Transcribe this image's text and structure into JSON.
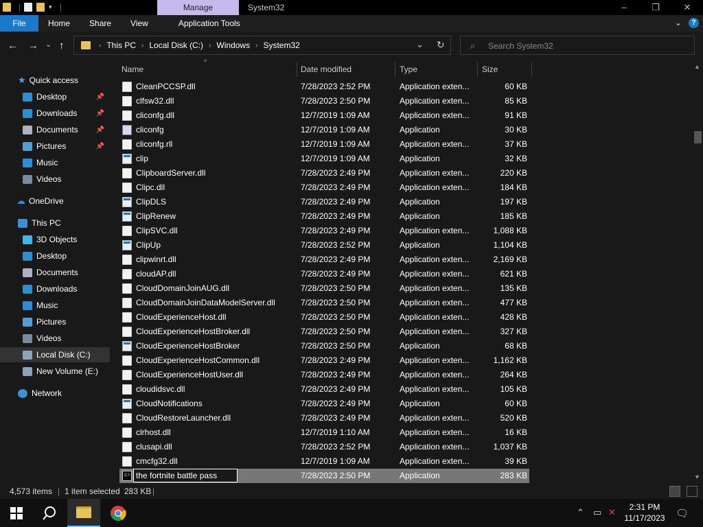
{
  "titlebar": {
    "manage_tab": "Manage",
    "system_tab": "System32",
    "minimize": "–",
    "maximize": "❐",
    "close": "✕"
  },
  "ribbon": {
    "tabs": [
      "File",
      "Home",
      "Share",
      "View",
      "Application Tools"
    ],
    "expand": "⌄",
    "help": "?"
  },
  "address": {
    "back": "←",
    "forward": "→",
    "recent": "⌄",
    "up": "↑",
    "crumbs": [
      "This PC",
      "Local Disk (C:)",
      "Windows",
      "System32"
    ],
    "dropdown": "⌄",
    "refresh": "↻"
  },
  "search": {
    "placeholder": "Search System32",
    "icon": "search-icon"
  },
  "nav": {
    "quick_access": "Quick access",
    "items": [
      {
        "label": "Desktop",
        "icon": "desktop-icon",
        "color": "#2b8fd8",
        "pinned": true
      },
      {
        "label": "Downloads",
        "icon": "download-icon",
        "color": "#2b8fd8",
        "pinned": true
      },
      {
        "label": "Documents",
        "icon": "documents-icon",
        "color": "#aab4c0",
        "pinned": true
      },
      {
        "label": "Pictures",
        "icon": "pictures-icon",
        "color": "#4fa0d8",
        "pinned": true
      },
      {
        "label": "Music",
        "icon": "music-icon",
        "color": "#2b8fd8",
        "pinned": false
      },
      {
        "label": "Videos",
        "icon": "videos-icon",
        "color": "#7a8aa0",
        "pinned": false
      }
    ],
    "onedrive": "OneDrive",
    "this_pc": "This PC",
    "pc_items": [
      {
        "label": "3D Objects",
        "icon": "3d-objects-icon",
        "color": "#3cb7e8"
      },
      {
        "label": "Desktop",
        "icon": "desktop-icon",
        "color": "#2b8fd8"
      },
      {
        "label": "Documents",
        "icon": "documents-icon",
        "color": "#aab4c0"
      },
      {
        "label": "Downloads",
        "icon": "download-icon",
        "color": "#2b8fd8"
      },
      {
        "label": "Music",
        "icon": "music-icon",
        "color": "#2b8fd8"
      },
      {
        "label": "Pictures",
        "icon": "pictures-icon",
        "color": "#4fa0d8"
      },
      {
        "label": "Videos",
        "icon": "videos-icon",
        "color": "#7a8aa0"
      },
      {
        "label": "Local Disk (C:)",
        "icon": "drive-icon",
        "color": "#8aa4c0"
      },
      {
        "label": "New Volume (E:)",
        "icon": "drive-icon",
        "color": "#8aa4c0"
      }
    ],
    "network": "Network"
  },
  "columns": {
    "name": "Name",
    "date": "Date modified",
    "type": "Type",
    "size": "Size"
  },
  "files": [
    {
      "name": "CleanPCCSP.dll",
      "date": "7/28/2023 2:52 PM",
      "type": "Application exten...",
      "size": "60 KB",
      "icon": "dll"
    },
    {
      "name": "clfsw32.dll",
      "date": "7/28/2023 2:50 PM",
      "type": "Application exten...",
      "size": "85 KB",
      "icon": "dll"
    },
    {
      "name": "cliconfg.dll",
      "date": "12/7/2019 1:09 AM",
      "type": "Application exten...",
      "size": "91 KB",
      "icon": "dll"
    },
    {
      "name": "cliconfg",
      "date": "12/7/2019 1:09 AM",
      "type": "Application",
      "size": "30 KB",
      "icon": "cfg"
    },
    {
      "name": "cliconfg.rll",
      "date": "12/7/2019 1:09 AM",
      "type": "Application exten...",
      "size": "37 KB",
      "icon": "dll"
    },
    {
      "name": "clip",
      "date": "12/7/2019 1:09 AM",
      "type": "Application",
      "size": "32 KB",
      "icon": "exe"
    },
    {
      "name": "ClipboardServer.dll",
      "date": "7/28/2023 2:49 PM",
      "type": "Application exten...",
      "size": "220 KB",
      "icon": "dll"
    },
    {
      "name": "Clipc.dll",
      "date": "7/28/2023 2:49 PM",
      "type": "Application exten...",
      "size": "184 KB",
      "icon": "dll"
    },
    {
      "name": "ClipDLS",
      "date": "7/28/2023 2:49 PM",
      "type": "Application",
      "size": "197 KB",
      "icon": "exe"
    },
    {
      "name": "ClipRenew",
      "date": "7/28/2023 2:49 PM",
      "type": "Application",
      "size": "185 KB",
      "icon": "exe"
    },
    {
      "name": "ClipSVC.dll",
      "date": "7/28/2023 2:49 PM",
      "type": "Application exten...",
      "size": "1,088 KB",
      "icon": "dll"
    },
    {
      "name": "ClipUp",
      "date": "7/28/2023 2:52 PM",
      "type": "Application",
      "size": "1,104 KB",
      "icon": "exe"
    },
    {
      "name": "clipwinrt.dll",
      "date": "7/28/2023 2:49 PM",
      "type": "Application exten...",
      "size": "2,169 KB",
      "icon": "dll"
    },
    {
      "name": "cloudAP.dll",
      "date": "7/28/2023 2:49 PM",
      "type": "Application exten...",
      "size": "621 KB",
      "icon": "dll"
    },
    {
      "name": "CloudDomainJoinAUG.dll",
      "date": "7/28/2023 2:50 PM",
      "type": "Application exten...",
      "size": "135 KB",
      "icon": "dll"
    },
    {
      "name": "CloudDomainJoinDataModelServer.dll",
      "date": "7/28/2023 2:50 PM",
      "type": "Application exten...",
      "size": "477 KB",
      "icon": "dll"
    },
    {
      "name": "CloudExperienceHost.dll",
      "date": "7/28/2023 2:50 PM",
      "type": "Application exten...",
      "size": "428 KB",
      "icon": "dll"
    },
    {
      "name": "CloudExperienceHostBroker.dll",
      "date": "7/28/2023 2:50 PM",
      "type": "Application exten...",
      "size": "327 KB",
      "icon": "dll"
    },
    {
      "name": "CloudExperienceHostBroker",
      "date": "7/28/2023 2:50 PM",
      "type": "Application",
      "size": "68 KB",
      "icon": "exe"
    },
    {
      "name": "CloudExperienceHostCommon.dll",
      "date": "7/28/2023 2:49 PM",
      "type": "Application exten...",
      "size": "1,162 KB",
      "icon": "dll"
    },
    {
      "name": "CloudExperienceHostUser.dll",
      "date": "7/28/2023 2:49 PM",
      "type": "Application exten...",
      "size": "264 KB",
      "icon": "dll"
    },
    {
      "name": "cloudidsvc.dll",
      "date": "7/28/2023 2:49 PM",
      "type": "Application exten...",
      "size": "105 KB",
      "icon": "dll"
    },
    {
      "name": "CloudNotifications",
      "date": "7/28/2023 2:49 PM",
      "type": "Application",
      "size": "60 KB",
      "icon": "exe"
    },
    {
      "name": "CloudRestoreLauncher.dll",
      "date": "7/28/2023 2:49 PM",
      "type": "Application exten...",
      "size": "520 KB",
      "icon": "dll"
    },
    {
      "name": "clrhost.dll",
      "date": "12/7/2019 1:10 AM",
      "type": "Application exten...",
      "size": "16 KB",
      "icon": "dll"
    },
    {
      "name": "clusapi.dll",
      "date": "7/28/2023 2:52 PM",
      "type": "Application exten...",
      "size": "1,037 KB",
      "icon": "dll"
    },
    {
      "name": "cmcfg32.dll",
      "date": "12/7/2019 1:09 AM",
      "type": "Application exten...",
      "size": "39 KB",
      "icon": "dll"
    },
    {
      "name": "the fortnite battle pass",
      "date": "7/28/2023 2:50 PM",
      "type": "Application",
      "size": "283 KB",
      "icon": "cmd",
      "selected": true,
      "renaming": true
    }
  ],
  "status": {
    "count": "4,573 items",
    "selected": "1 item selected",
    "size": "283 KB"
  },
  "taskbar": {
    "time": "2:31 PM",
    "date": "11/17/2023"
  },
  "colors": {
    "accent": "#1979ca",
    "manage_tab": "#c6b9ee",
    "selection": "#777777",
    "background": "#191919"
  }
}
